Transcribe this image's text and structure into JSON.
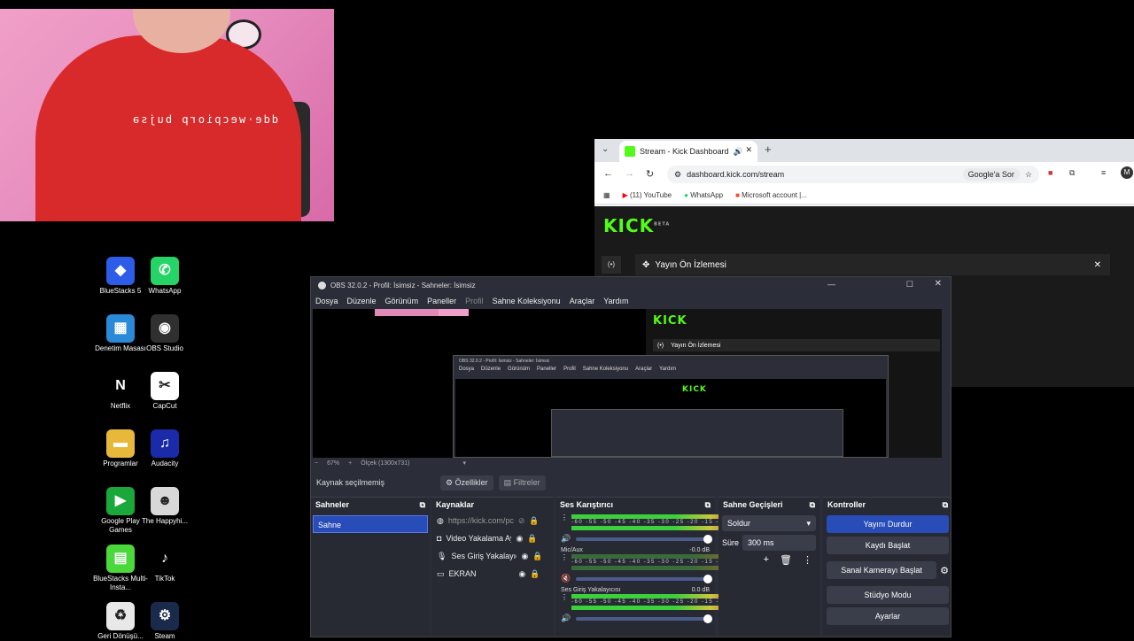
{
  "webcam": {
    "mirror_text": "dde·wecpiorp bujsə"
  },
  "desktop": {
    "icons": [
      {
        "name": "BlueStacks 5",
        "sym": "◆",
        "bg": "#2c5ce8"
      },
      {
        "name": "WhatsApp",
        "sym": "✆",
        "bg": "#25d366"
      },
      {
        "name": "Denetim Masası",
        "sym": "▦",
        "bg": "#2a8ad8"
      },
      {
        "name": "OBS Studio",
        "sym": "◉",
        "bg": "#303030"
      },
      {
        "name": "Netflix",
        "sym": "N",
        "bg": "#000000"
      },
      {
        "name": "CapCut",
        "sym": "✂",
        "bg": "#ffffff"
      },
      {
        "name": "Programlar",
        "sym": "▬",
        "bg": "#e8b83a"
      },
      {
        "name": "Audacity",
        "sym": "♫",
        "bg": "#1a2aa8"
      },
      {
        "name": "Google Play Games",
        "sym": "▶",
        "bg": "#1aa83a"
      },
      {
        "name": "The Happyhi...",
        "sym": "☻",
        "bg": "#d8d8d8"
      },
      {
        "name": "BlueStacks Multi-Insta...",
        "sym": "▤",
        "bg": "#4ad83a"
      },
      {
        "name": "TikTok",
        "sym": "♪",
        "bg": "#000000"
      },
      {
        "name": "Geri Dönüşü...",
        "sym": "♻",
        "bg": "#e8e8e8"
      },
      {
        "name": "Steam",
        "sym": "⚙",
        "bg": "#1a2a4a"
      }
    ]
  },
  "browser": {
    "tab_title": "Stream - Kick Dashboard",
    "url": "dashboard.kick.com/stream",
    "google_btn": "Google'a Sor",
    "bookmarks": [
      "(11) YouTube",
      "WhatsApp",
      "Microsoft account |..."
    ],
    "logo": "KICK",
    "logo_sup": "BETA",
    "panel_title": "Yayın Ön İzlemesi",
    "broadcast_icon": "(•)"
  },
  "obs": {
    "title": "OBS 32.0.2 - Profil: İsimsiz - Sahneler: İsimsiz",
    "menu": [
      "Dosya",
      "Düzenle",
      "Görünüm",
      "Paneller",
      "Profil",
      "Sahne Koleksiyonu",
      "Araçlar",
      "Yardım"
    ],
    "zoom": "67%",
    "scale": "Ölçek (1300x731)",
    "nested_title": "OBS 32.0.2 - Profil: İsimsiz - Sahneler: İsimsiz",
    "context": {
      "no_source": "Kaynak seçilmemiş",
      "properties": "Özellikler",
      "filters": "Filtreler"
    },
    "scenes": {
      "header": "Sahneler",
      "items": [
        "Sahne"
      ]
    },
    "sources": {
      "header": "Kaynaklar",
      "items": [
        "https://kick.com/pc",
        "Video Yakalama Ay",
        "Ses Giriş Yakalayıcı",
        "EKRAN"
      ]
    },
    "mixer": {
      "header": "Ses Karıştırıcı",
      "scale": "-60 -55 -50 -45 -40 -35 -30 -25 -20 -15 -10 -5 0",
      "channels": [
        {
          "name": "",
          "db": ""
        },
        {
          "name": "Mic/Aux",
          "db": "-0.0 dB"
        },
        {
          "name": "Ses Giriş Yakalayıcısı",
          "db": "0.0 dB"
        }
      ]
    },
    "transitions": {
      "header": "Sahne Geçişleri",
      "type": "Soldur",
      "duration_label": "Süre",
      "duration": "300 ms"
    },
    "controls": {
      "header": "Kontroller",
      "stop_stream": "Yayını Durdur",
      "start_record": "Kaydı Başlat",
      "virtual_cam": "Sanal Kamerayı Başlat",
      "studio_mode": "Stüdyo Modu",
      "settings": "Ayarlar"
    }
  }
}
